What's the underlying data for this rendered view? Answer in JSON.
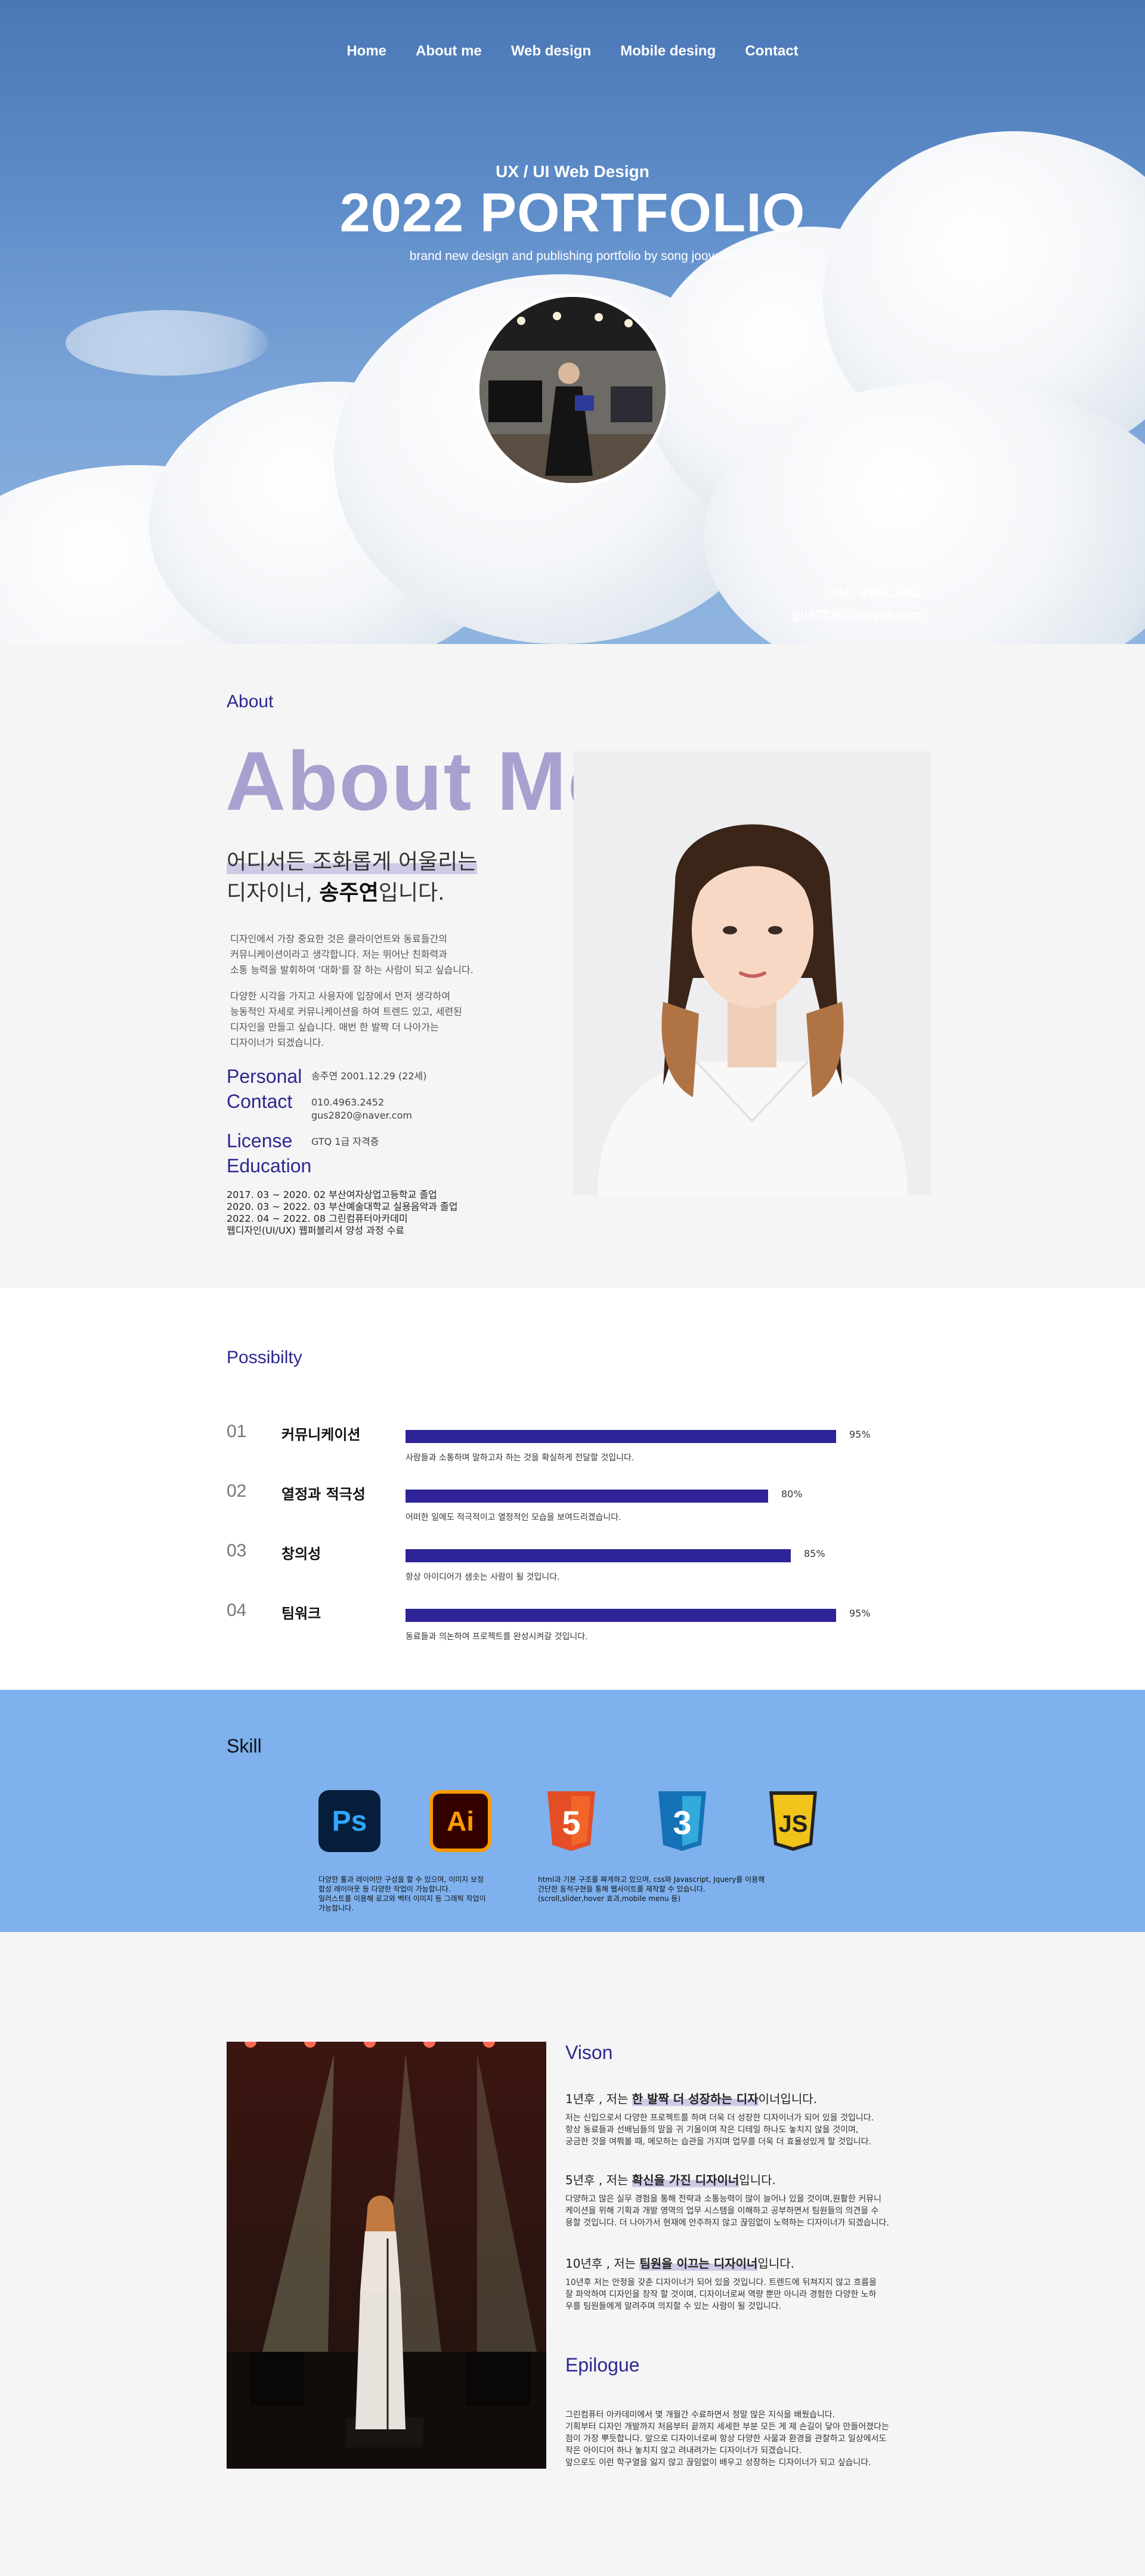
{
  "nav": {
    "items": [
      "Home",
      "About me",
      "Web design",
      "Mobile desing",
      "Contact"
    ]
  },
  "hero": {
    "subtitle": "UX / UI Web Design",
    "title": "2022 PORTFOLIO",
    "description": "brand new design and publishing portfolio by song jooyeon",
    "phone": "010. 4963.2452",
    "email": "gus2820@naver.com"
  },
  "about": {
    "section_label": "About",
    "heading": "About Me",
    "tagline_line1": "어디서든 조화롭게 어울리는",
    "tagline_line2_pre": "디자이너, ",
    "tagline_name": "송주연",
    "tagline_line2_post": "입니다.",
    "paragraph1": [
      "디자인에서 가장 중요한 것은 클라이언트와 동료들간의",
      "커뮤니케이션이라고 생각합니다. 저는 뛰어난 친화력과",
      "소통 능력을 발휘하여 '대화'를 잘 하는 사람이 되고 싶습니다."
    ],
    "paragraph2": [
      "다양한 시각을 가지고 사용자에 입장에서 먼저 생각하여",
      "능동적인 자세로 커뮤니케이션을 하여 트렌드 있고, 세련된",
      "디자인을 만들고 싶습니다. 매번 한 발짝 더 나아가는",
      "디자이너가 되겠습니다."
    ],
    "personal_label": "Personal",
    "personal_value": "송주연 2001.12.29 (22세)",
    "contact_label": "Contact",
    "contact_phone": "010.4963.2452",
    "contact_email": "gus2820@naver.com",
    "license_label": "License",
    "license_value": "GTQ 1급 자격증",
    "education_label": "Education",
    "education": [
      "2017. 03 ~ 2020. 02 부산여자상업고등학교 졸업",
      "2020. 03 ~ 2022. 03 부산예술대학교 실용음악과 졸업",
      "2022. 04 ~ 2022. 08 그린컴퓨터아카데미",
      "웹디자인(UI/UX) 웹퍼블리셔 양성 과정 수료"
    ]
  },
  "possibility": {
    "section_label": "Possibilty",
    "items": [
      {
        "num": "01",
        "name": "커뮤니케이션",
        "percent": 95,
        "percent_label": "95%",
        "desc": "사람들과 소통하며 말하고자 하는 것을 확실하게 전달할 것입니다."
      },
      {
        "num": "02",
        "name": "열정과 적극성",
        "percent": 80,
        "percent_label": "80%",
        "desc": "어떠한 일에도 적극적이고 열정적인 모습을 보여드리겠습니다."
      },
      {
        "num": "03",
        "name": "창의성",
        "percent": 85,
        "percent_label": "85%",
        "desc": "항상 아이디어가 샘솟는 사람이 될 것입니다."
      },
      {
        "num": "04",
        "name": "팀워크",
        "percent": 95,
        "percent_label": "95%",
        "desc": "동료들과 의논하여 프로젝트를 완성시켜갈 것입니다."
      }
    ]
  },
  "skill": {
    "title": "Skill",
    "icons": [
      {
        "name": "photoshop-icon",
        "text": "Ps",
        "bg": "#061e3c",
        "fg": "#31a8ff"
      },
      {
        "name": "illustrator-icon",
        "text": "Ai",
        "bg": "#330000",
        "fg": "#ff9a00"
      },
      {
        "name": "html5-icon",
        "text": "5",
        "bg": "#e44d26",
        "fg": "#ffffff"
      },
      {
        "name": "css3-icon",
        "text": "3",
        "bg": "#1572b6",
        "fg": "#ffffff"
      },
      {
        "name": "javascript-icon",
        "text": "JS",
        "bg": "#f0c419",
        "fg": "#222222"
      }
    ],
    "desc_left": [
      "다양한 툴과 레이어만 구성을 할 수 있으며, 이미지 보정",
      "합성 레이아웃 등 다양한 작업이 가능합니다.",
      "일러스트를 이용해 로고와 벡터 이미지 등 그래픽 작업이",
      "가능합니다."
    ],
    "desc_right": [
      "html과 기본 구조를 짜게하고 있으며, css와 Javascript, Jquery를 이용해",
      "간단한 동적구현을 통해 웹사이트를 제작할 수 있습니다.",
      "(scroll,slider,hover 효과,mobile menu 등)"
    ]
  },
  "vision": {
    "heading": "Vison",
    "blocks": [
      {
        "pre": "1년후 , 저는 ",
        "highlight": "한 발짝 더 성장하는 디자",
        "post": "이너입니다.",
        "text": [
          "저는 신입으로서 다양한 프로젝트를 하며 더욱 더 성장한 디자이너가 되어 있을 것입니다.",
          "항상 동료들과 선배님들의 말을 귀 기울이며 작은 디테일 하나도 놓치지 않을 것이며,",
          "궁금한 것을 여쭤볼 때, 메모하는 습관을 가지며 업무를 더욱 더 효율성있게 할 것입니다."
        ]
      },
      {
        "pre": "5년후 , 저는 ",
        "highlight": "확신을 가진 디자이너",
        "post": "입니다.",
        "text": [
          "다양하고 많은 실무 경험을 통해 전략과 소통능력이 많이 늘어나 있을 것이며,원활한 커뮤니",
          "케이션을 위해 기획과 개발 영역의 업무 시스템을 이해하고 공부하면서 팀원들의 의견을 수",
          "용할 것입니다. 더 나아가서 현재에 안주하지 않고 끊임없이 노력하는 디자이너가 되겠습니다."
        ]
      },
      {
        "pre": "10년후 , 저는 ",
        "highlight": "팀원을 이끄는 디자이너",
        "post": "입니다.",
        "text": [
          "10년후 저는 안정을 갖춘 디자이너가 되어 있을 것입니다. 트렌드에 뒤쳐지지 않고 흐름을",
          "잘 파악하여 디자인을 창작 할 것이며, 디자이너로써 역량 뿐만 아니라 경험한 다양한 노하",
          "우를 팀원들에게 알려주며 의지할 수 있는 사람이 될 것입니다."
        ]
      }
    ],
    "epilogue_heading": "Epilogue",
    "epilogue_text": [
      "그린컴퓨터 아카데미에서 몇 개월간 수료하면서 정말 많은 지식을 배웠습니다.",
      "기획부터 디자인 개발까지 처음부터 끝까지 세세한 부분 모든 게 제 손길이 닿아 만들어졌다는",
      "점이 가장 뿌듯합니다. 앞으로 디자이너로써 항상 다양한 사물과 환경을 관찰하고 일상에서도",
      "작은 아이디어 하나 놓치지 않고 려내려가는 디자이너가 되겠습니다.",
      "앞으로도 이런 학구열을 잃지 않고 끊임없이 배우고 성장하는 디자이너가 되고 싶습니다."
    ]
  }
}
